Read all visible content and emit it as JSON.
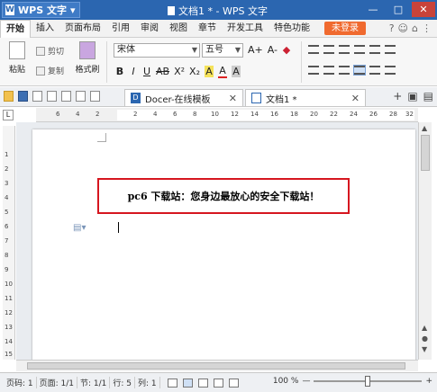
{
  "titlebar": {
    "app_name": "WPS 文字",
    "doc_title": "文档1 * - WPS 文字",
    "controls": [
      "—",
      "□",
      "✕"
    ]
  },
  "menubar": {
    "tabs": [
      "开始",
      "插入",
      "页面布局",
      "引用",
      "审阅",
      "视图",
      "章节",
      "开发工具",
      "特色功能"
    ],
    "login": "未登录",
    "right_icons": [
      "?",
      "☺",
      "⌂",
      "⋮"
    ]
  },
  "ribbon": {
    "paste": "粘贴",
    "cut": "剪切",
    "copy": "复制",
    "format_painter": "格式刷",
    "font_name": "宋体",
    "font_size": "五号",
    "font_grow": "A+",
    "font_shrink": "A-",
    "format_buttons": [
      "B",
      "I",
      "U",
      "AB",
      "X²",
      "X₂",
      "A",
      "A",
      "A"
    ]
  },
  "quickbar": {
    "tabs": [
      {
        "label": "Docer-在线模板",
        "icon": "D"
      },
      {
        "label": "文档1 *",
        "icon": "W"
      }
    ],
    "add": "+"
  },
  "ruler": {
    "corner": "L",
    "h_ticks": [
      "6",
      "4",
      "2",
      "2",
      "4",
      "6",
      "8",
      "10",
      "12",
      "14",
      "16",
      "18",
      "20",
      "22",
      "24",
      "26",
      "28",
      "32"
    ],
    "v_ticks": [
      "1",
      "2",
      "3",
      "4",
      "5",
      "6",
      "7",
      "8",
      "9",
      "10",
      "11",
      "12",
      "13",
      "14",
      "15"
    ]
  },
  "document": {
    "banner_text": "pc6 下载站：您身边最放心的安全下载站！"
  },
  "statusbar": {
    "page_code": "页码: 1",
    "pages": "页面: 1/1",
    "section": "节: 1/1",
    "row": "行: 5",
    "col": "列: 1",
    "zoom_label": "100 %",
    "zoom_minus": "—",
    "zoom_plus": "+"
  },
  "colors": {
    "title_bg": "#2b66b0",
    "login_bg": "#f06a2f",
    "highlight_border": "#d6161f"
  }
}
